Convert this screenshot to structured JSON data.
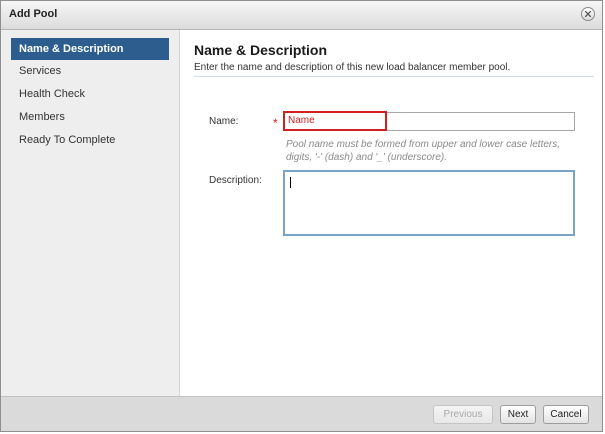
{
  "window": {
    "title": "Add Pool"
  },
  "sidebar": {
    "steps": [
      {
        "label": "Name & Description",
        "active": true
      },
      {
        "label": "Services",
        "active": false
      },
      {
        "label": "Health Check",
        "active": false
      },
      {
        "label": "Members",
        "active": false
      },
      {
        "label": "Ready To Complete",
        "active": false
      }
    ]
  },
  "main": {
    "heading": "Name & Description",
    "subheading": "Enter the name and description of this new load balancer member pool.",
    "name_field": {
      "label": "Name:",
      "required_marker": "*",
      "value": "Name",
      "hint": "Pool name must be formed from upper and lower case letters, digits, '-' (dash) and '_' (underscore)."
    },
    "description_field": {
      "label": "Description:",
      "value": ""
    }
  },
  "footer": {
    "previous_label": "Previous",
    "next_label": "Next",
    "cancel_label": "Cancel"
  },
  "colors": {
    "active_step": "#2d5d8e",
    "required": "#d21f1f",
    "focus_border": "#7aa3c5"
  }
}
